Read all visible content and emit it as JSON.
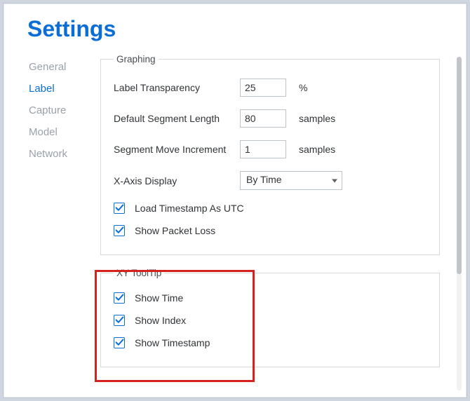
{
  "title": "Settings",
  "sidebar": {
    "items": [
      {
        "label": "General"
      },
      {
        "label": "Label"
      },
      {
        "label": "Capture"
      },
      {
        "label": "Model"
      },
      {
        "label": "Network"
      }
    ],
    "active_index": 1
  },
  "graphing": {
    "legend": "Graphing",
    "label_transparency": {
      "label": "Label Transparency",
      "value": "25",
      "unit": "%"
    },
    "default_segment_length": {
      "label": "Default Segment Length",
      "value": "80",
      "unit": "samples"
    },
    "segment_move_increment": {
      "label": "Segment Move Increment",
      "value": "1",
      "unit": "samples"
    },
    "x_axis_display": {
      "label": "X-Axis Display",
      "value": "By Time"
    },
    "load_timestamp_utc": {
      "label": "Load Timestamp As UTC",
      "checked": true
    },
    "show_packet_loss": {
      "label": "Show Packet Loss",
      "checked": true
    }
  },
  "xy_tooltip": {
    "legend": "XY ToolTip",
    "show_time": {
      "label": "Show Time",
      "checked": true
    },
    "show_index": {
      "label": "Show Index",
      "checked": true
    },
    "show_timestamp": {
      "label": "Show Timestamp",
      "checked": true
    }
  }
}
